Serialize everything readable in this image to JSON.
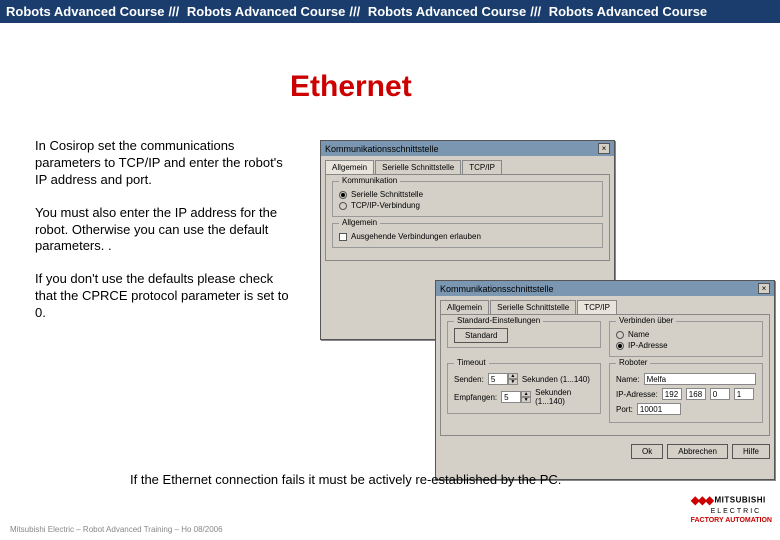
{
  "banner": {
    "text": "Robots Advanced Course",
    "sep": "///"
  },
  "title": "Ethernet",
  "paragraphs": {
    "p1": "In Cosirop set the communications parameters to TCP/IP and enter the robot's IP address and port.",
    "p2": "You must also enter the IP address for the robot. Otherwise you can use the default parameters. .",
    "p3": "If you don't use the defaults please check that the CPRCE protocol parameter is set to 0."
  },
  "bottom": "If the Ethernet connection fails it must be actively re-established by the PC.",
  "footer": "Mitsubishi Electric – Robot Advanced Training – Ho 08/2006",
  "logo": {
    "brand": "MITSUBISHI",
    "elec": "ELECTRIC",
    "sub": "FACTORY AUTOMATION"
  },
  "dlg1": {
    "title": "Kommunikationsschnittstelle",
    "tabs": [
      "Allgemein",
      "Serielle Schnittstelle",
      "TCP/IP"
    ],
    "grp_comm": "Kommunikation",
    "opt_serial": "Serielle Schnittstelle",
    "opt_tcpip": "TCP/IP-Verbindung",
    "grp_common": "Allgemein",
    "chk_handshake": "Ausgehende Verbindungen erlauben"
  },
  "dlg2": {
    "title": "Kommunikationsschnittstelle",
    "tabs": [
      "Allgemein",
      "Serielle Schnittstelle",
      "TCP/IP"
    ],
    "grp_def": "Standard-Einstellungen",
    "btn_std": "Standard",
    "grp_verb": "Verbinden über",
    "opt_name": "Name",
    "opt_ip": "IP-Adresse",
    "grp_timeout": "Timeout",
    "lbl_send": "Senden:",
    "lbl_recv": "Empfangen:",
    "val_send": "5",
    "val_recv": "5",
    "unit": "Sekunden (1...140)",
    "grp_robot": "Roboter",
    "lbl_name": "Name:",
    "val_name": "Melfa",
    "lbl_ipaddr": "IP-Adresse:",
    "ip": [
      "192",
      "168",
      "0",
      "1"
    ],
    "lbl_port": "Port:",
    "val_port": "10001",
    "btn_ok": "Ok",
    "btn_cancel": "Abbrechen",
    "btn_help": "Hilfe"
  }
}
